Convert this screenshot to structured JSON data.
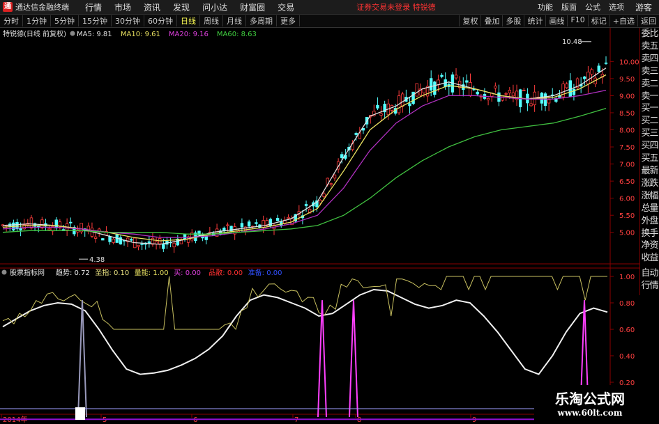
{
  "menu": {
    "app_title": "通达信金融终端",
    "items": [
      "行情",
      "市场",
      "资讯",
      "发现",
      "问小达",
      "财富圈",
      "交易"
    ],
    "notice": "证券交易未登录",
    "stock_name": "特锐德",
    "right": [
      "功能",
      "版面",
      "公式",
      "选项"
    ],
    "guest": "游客"
  },
  "periods": [
    "分时",
    "1分钟",
    "5分钟",
    "15分钟",
    "30分钟",
    "60分钟",
    "日线",
    "周线",
    "月线",
    "多周期",
    "更多"
  ],
  "active_period": "日线",
  "tools": [
    "复权",
    "叠加",
    "多股",
    "统计",
    "画线",
    "F10",
    "标记",
    "+自选",
    "返回"
  ],
  "sidebar": [
    "委比",
    "卖五",
    "卖四",
    "卖三",
    "卖二",
    "卖一",
    "买一",
    "买二",
    "买三",
    "买四",
    "买五",
    "最新",
    "涨跌",
    "涨幅",
    "总量",
    "外盘",
    "换手",
    "净资",
    "收益"
  ],
  "sidebar2": [
    "自动",
    "行情"
  ],
  "main_header": {
    "title": "特锐德(日线 前复权)",
    "ma": [
      {
        "label": "MA5: 9.81",
        "color": "#e0e0e0"
      },
      {
        "label": "MA10: 9.61",
        "color": "#e8e060"
      },
      {
        "label": "MA20: 9.16",
        "color": "#e040e0"
      },
      {
        "label": "MA60: 8.63",
        "color": "#40d040"
      }
    ]
  },
  "indicator_header": {
    "title": "股票指标网",
    "items": [
      {
        "label": "趋势: 0.72",
        "color": "#f0f0f0"
      },
      {
        "label": "圣指: 0.10",
        "color": "#e8e080"
      },
      {
        "label": "量能: 1.00",
        "color": "#e8e060"
      },
      {
        "label": "买: 0.00",
        "color": "#e040e0"
      },
      {
        "label": "品散: 0.00",
        "color": "#ff3030"
      },
      {
        "label": "准备: 0.00",
        "color": "#3050ff"
      }
    ]
  },
  "price_axis": [
    "10.00",
    "9.50",
    "9.00",
    "8.50",
    "8.00",
    "7.50",
    "7.00",
    "6.50",
    "6.00",
    "5.50",
    "5.00"
  ],
  "indicator_axis": [
    "1.00",
    "0.80",
    "0.60",
    "0.40",
    "0.20"
  ],
  "date_axis": [
    "2014年",
    "5",
    "6",
    "7",
    "8",
    "9"
  ],
  "annotations": {
    "high": "10.48",
    "low": "4.38",
    "price_label_top": "10.00"
  },
  "watermark": {
    "line1": "乐淘公式网",
    "line2": "www.60lt.com"
  },
  "chart_data": {
    "type": "line",
    "title": "特锐德(日线 前复权)",
    "ylim": [
      4.2,
      10.7
    ],
    "x": [
      "2014年",
      "5",
      "6",
      "7",
      "8",
      "9"
    ],
    "series": [
      {
        "name": "MA5",
        "values": [
          5.2,
          5.25,
          5.2,
          5.1,
          4.9,
          4.7,
          4.65,
          4.8,
          5.0,
          5.1,
          5.2,
          5.4,
          5.9,
          7.2,
          8.4,
          8.7,
          9.2,
          9.4,
          9.2,
          9.0,
          8.9,
          9.0,
          9.3,
          9.81
        ]
      },
      {
        "name": "MA10",
        "values": [
          5.15,
          5.2,
          5.2,
          5.1,
          5.0,
          4.85,
          4.75,
          4.8,
          4.95,
          5.05,
          5.15,
          5.3,
          5.7,
          6.8,
          8.0,
          8.6,
          9.0,
          9.3,
          9.2,
          9.0,
          8.9,
          8.95,
          9.2,
          9.61
        ]
      },
      {
        "name": "MA20",
        "values": [
          5.1,
          5.15,
          5.15,
          5.1,
          5.0,
          4.95,
          4.85,
          4.85,
          4.9,
          5.0,
          5.1,
          5.25,
          5.5,
          6.3,
          7.4,
          8.2,
          8.7,
          9.0,
          9.0,
          8.95,
          8.9,
          8.9,
          9.0,
          9.16
        ]
      },
      {
        "name": "MA60",
        "values": [
          5.0,
          5.05,
          5.05,
          5.05,
          5.0,
          5.0,
          5.0,
          4.95,
          4.95,
          5.0,
          5.05,
          5.1,
          5.2,
          5.5,
          6.0,
          6.6,
          7.1,
          7.5,
          7.8,
          8.0,
          8.1,
          8.2,
          8.4,
          8.63
        ]
      }
    ]
  }
}
